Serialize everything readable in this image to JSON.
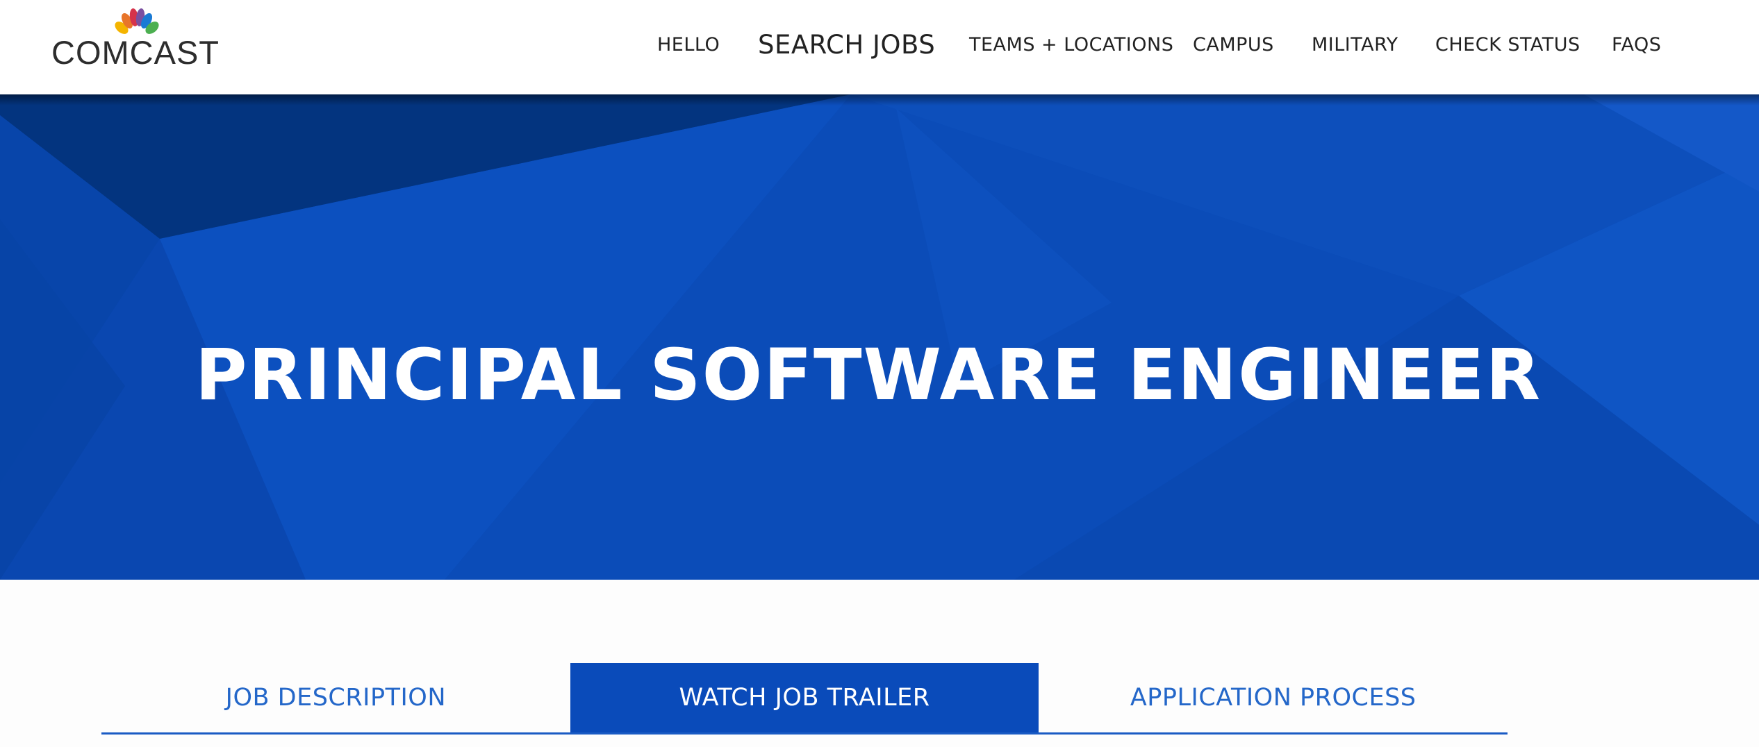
{
  "brand": {
    "name": "COMCAST",
    "logo_icon": "peacock-icon",
    "colors": {
      "primary_blue": "#0a4bba",
      "link_blue": "#2467c9",
      "text_dark": "#222222"
    }
  },
  "nav": {
    "items": [
      {
        "label": "HELLO"
      },
      {
        "label": "SEARCH JOBS"
      },
      {
        "label": "TEAMS + LOCATIONS"
      },
      {
        "label": "CAMPUS"
      },
      {
        "label": "MILITARY"
      },
      {
        "label": "CHECK STATUS"
      },
      {
        "label": "FAQS"
      }
    ]
  },
  "hero": {
    "title": "PRINCIPAL SOFTWARE ENGINEER"
  },
  "tabs": {
    "items": [
      {
        "label": "JOB DESCRIPTION",
        "active": false
      },
      {
        "label": "WATCH JOB TRAILER",
        "active": true
      },
      {
        "label": "APPLICATION PROCESS",
        "active": false
      }
    ]
  }
}
